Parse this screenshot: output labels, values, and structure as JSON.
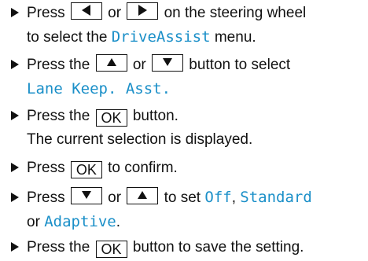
{
  "steps": [
    {
      "press": "Press",
      "or": "or",
      "rest": "on the steering wheel",
      "line2_pre": "to select the",
      "menu": "DriveAssist",
      "line2_post": "menu."
    },
    {
      "press_the": "Press the",
      "or": "or",
      "rest": "button to select",
      "menu": "Lane Keep. Asst."
    },
    {
      "press_the": "Press the",
      "ok": "OK",
      "rest": "button.",
      "line2": "The current selection is displayed."
    },
    {
      "press": "Press",
      "ok": "OK",
      "rest": "to confirm."
    },
    {
      "press": "Press",
      "or": "or",
      "to_set": "to set",
      "opt1": "Off",
      "opt2": "Standard",
      "or2": "or",
      "opt3": "Adaptive"
    },
    {
      "press_the": "Press the",
      "ok": "OK",
      "rest": "button to save the setting."
    }
  ],
  "icons": {
    "left": "left-triangle-icon",
    "right": "right-triangle-icon",
    "up": "up-triangle-icon",
    "down": "down-triangle-icon",
    "bullet": "arrow-bullet-icon"
  },
  "colors": {
    "text": "#111111",
    "highlight": "#1a8fc8"
  }
}
